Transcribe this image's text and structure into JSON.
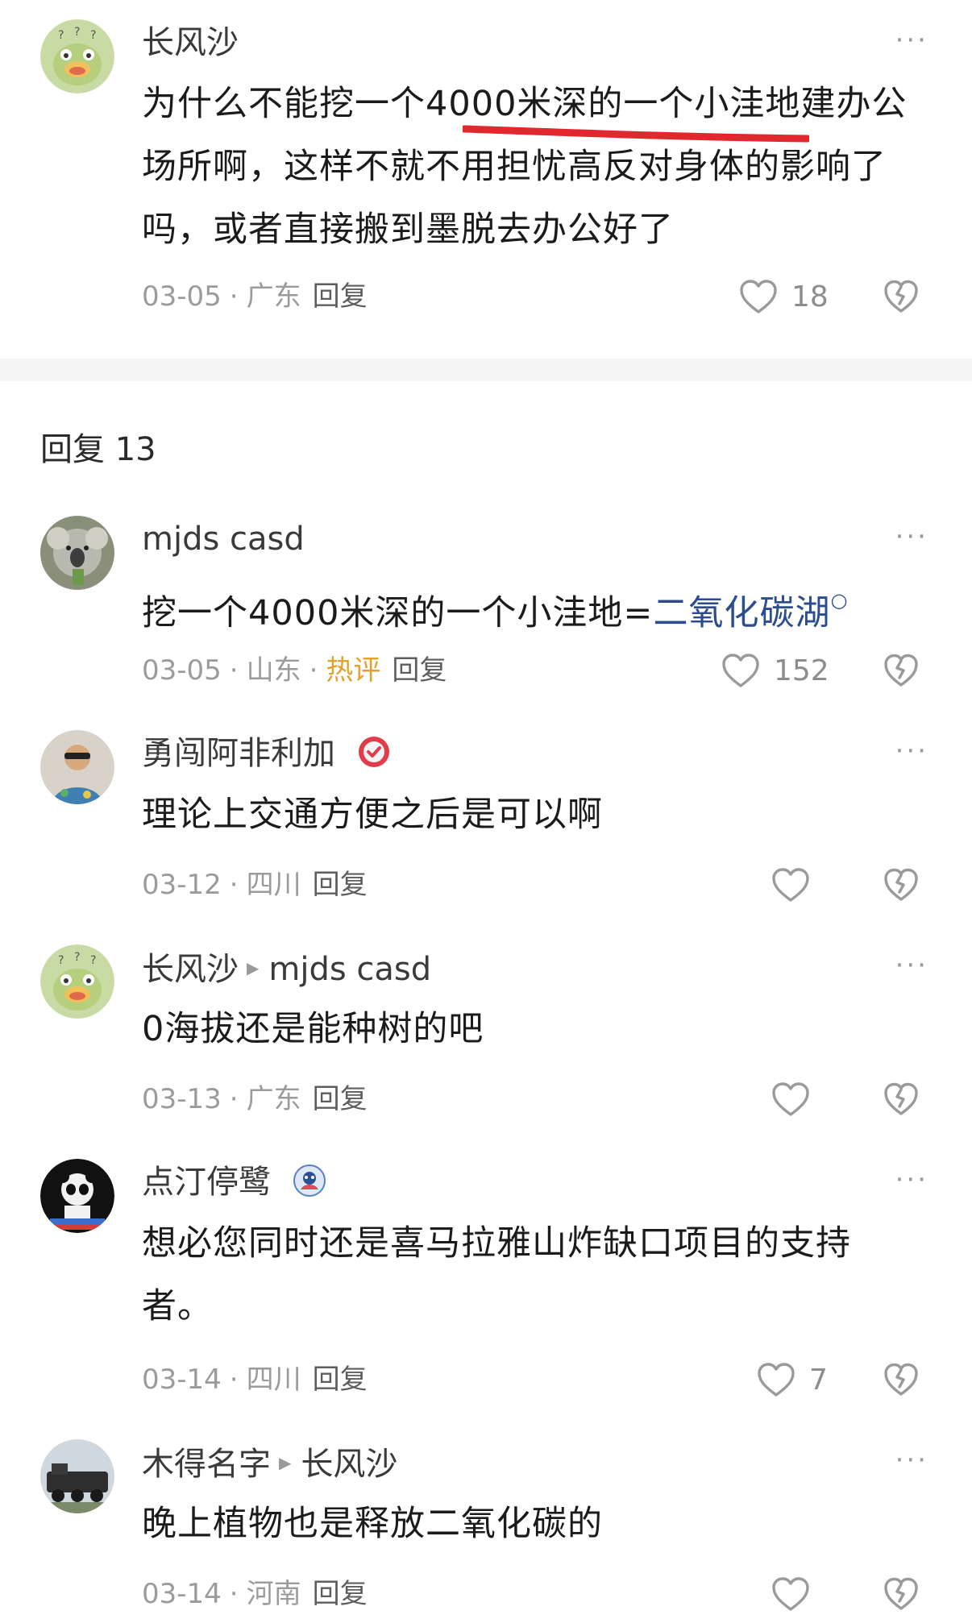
{
  "main_comment": {
    "author": "长风沙",
    "text_line1": "为什么不能挖一个4000米深的一个小洼地建办公",
    "text_line2": "场所啊，这样不就不用担忧高反对身体的影响了",
    "text_line3": "吗，或者直接搬到墨脱去办公好了",
    "date": "03-05",
    "location": "广东",
    "reply_label": "回复",
    "likes": "18"
  },
  "replies_header": "回复 13",
  "replies": [
    {
      "author": "mjds casd",
      "text_prefix": "挖一个4000米深的一个小洼地=",
      "link_text": "二氧化碳湖",
      "date": "03-05",
      "location": "山东",
      "tag": "热评",
      "reply_label": "回复",
      "likes": "152"
    },
    {
      "author": "勇闯阿非利加",
      "text": "理论上交通方便之后是可以啊",
      "date": "03-12",
      "location": "四川",
      "reply_label": "回复",
      "likes": ""
    },
    {
      "author": "长风沙",
      "reply_to": "mjds casd",
      "text": "0海拔还是能种树的吧",
      "date": "03-13",
      "location": "广东",
      "reply_label": "回复",
      "likes": ""
    },
    {
      "author": "点汀停鹭",
      "text": "想必您同时还是喜马拉雅山炸缺口项目的支持者。",
      "date": "03-14",
      "location": "四川",
      "reply_label": "回复",
      "likes": "7"
    },
    {
      "author": "木得名字",
      "reply_to": "长风沙",
      "text": "晚上植物也是释放二氧化碳的",
      "date": "03-14",
      "location": "河南",
      "reply_label": "回复",
      "likes": ""
    }
  ],
  "more_glyph": "···",
  "dot_sep": "·",
  "colors": {
    "hot_tag": "#e5a22b",
    "link": "#2b4d8f",
    "underline": "#e0282e",
    "meta_gray": "#9b9b9b"
  },
  "icons": [
    "more-options-icon",
    "heart-icon",
    "dislike-heart-icon",
    "verified-badge-icon",
    "search-link-icon"
  ]
}
